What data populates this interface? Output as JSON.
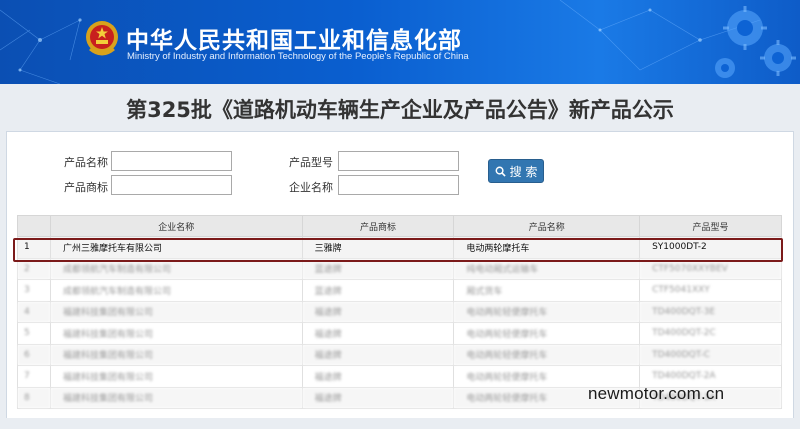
{
  "header": {
    "title": "中华人民共和国工业和信息化部",
    "subtitle": "Ministry of Industry and Information Technology of the People's Republic of China"
  },
  "notice": {
    "title": "第325批《道路机动车辆生产企业及产品公告》新产品公示"
  },
  "search": {
    "product_name_label": "产品名称",
    "product_brand_label": "产品商标",
    "product_model_label": "产品型号",
    "company_name_label": "企业名称",
    "button_label": "搜 索",
    "product_name_value": "",
    "product_brand_value": "",
    "product_model_value": "",
    "company_name_value": ""
  },
  "table": {
    "columns": [
      "",
      "企业名称",
      "产品商标",
      "产品名称",
      "产品型号"
    ],
    "rows": [
      {
        "idx": "1",
        "company": "广州三雅摩托车有限公司",
        "brand": "三雅牌",
        "name": "电动两轮摩托车",
        "model": "SY1000DT-2"
      },
      {
        "idx": "2",
        "company": "成都领航汽车制造有限公司",
        "brand": "蓝途牌",
        "name": "纯电动厢式运输车",
        "model": "CTF5070XXYBEV"
      },
      {
        "idx": "3",
        "company": "成都领航汽车制造有限公司",
        "brand": "蓝途牌",
        "name": "厢式货车",
        "model": "CTF5041XXY"
      },
      {
        "idx": "4",
        "company": "福建科技集团有限公司",
        "brand": "福途牌",
        "name": "电动两轮轻便摩托车",
        "model": "TD400DQT-3E"
      },
      {
        "idx": "5",
        "company": "福建科技集团有限公司",
        "brand": "福途牌",
        "name": "电动两轮轻便摩托车",
        "model": "TD400DQT-2C"
      },
      {
        "idx": "6",
        "company": "福建科技集团有限公司",
        "brand": "福途牌",
        "name": "电动两轮轻便摩托车",
        "model": "TD400DQT-C"
      },
      {
        "idx": "7",
        "company": "福建科技集团有限公司",
        "brand": "福途牌",
        "name": "电动两轮轻便摩托车",
        "model": "TD400DQT-2A"
      },
      {
        "idx": "8",
        "company": "福建科技集团有限公司",
        "brand": "福途牌",
        "name": "电动两轮轻便摩托车",
        "model": "TD400DQT-3A"
      }
    ]
  },
  "watermark": "newmotor.com.cn",
  "colors": {
    "banner_blue": "#0a5fd0",
    "button_blue": "#3276b1",
    "highlight_border": "#7b1a1a"
  }
}
